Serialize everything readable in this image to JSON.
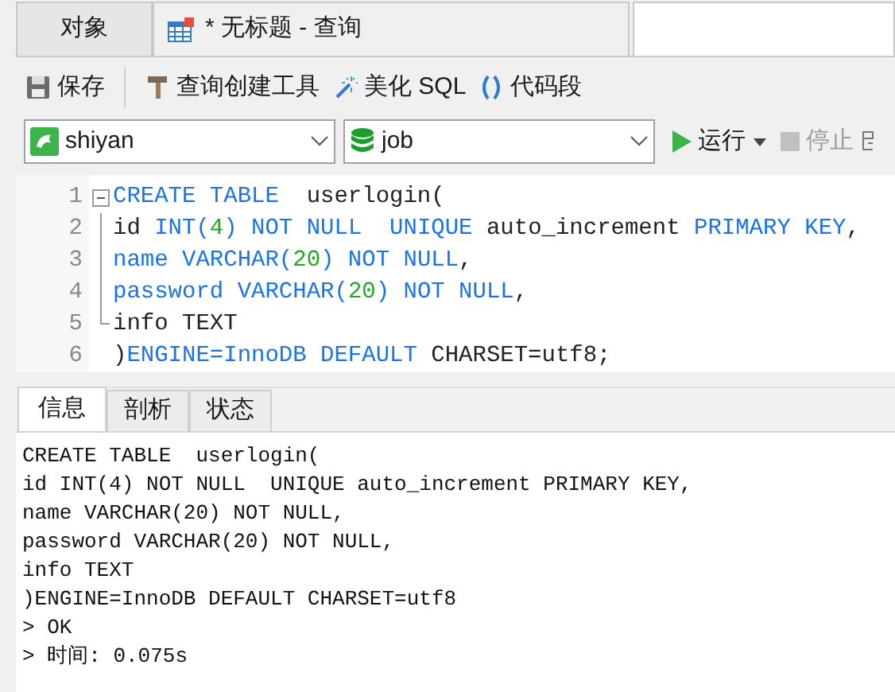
{
  "tabs": [
    {
      "label": "对象",
      "selected": false,
      "kind": "plain"
    },
    {
      "label": "* 无标题 - 查询",
      "selected": true,
      "kind": "query"
    }
  ],
  "toolbar": [
    {
      "label": "保存",
      "kind": "save"
    },
    {
      "label": "查询创建工具",
      "kind": "builder"
    },
    {
      "label": "美化 SQL",
      "kind": "beautify"
    },
    {
      "label": "代码段",
      "kind": "snippet"
    }
  ],
  "connection": {
    "value": "shiyan"
  },
  "database": {
    "value": "job"
  },
  "run": {
    "label": "运行",
    "disabled": false
  },
  "stop": {
    "label": "停止",
    "disabled": true
  },
  "editor": {
    "lines": [
      {
        "number": "1",
        "tokens": [
          {
            "text": "CREATE TABLE",
            "kind": "keyword"
          },
          {
            "text": "  userlogin(",
            "kind": "plain"
          }
        ]
      },
      {
        "number": "2",
        "tokens": [
          {
            "text": "id ",
            "kind": "plain"
          },
          {
            "text": "INT(",
            "kind": "keyword"
          },
          {
            "text": "4",
            "kind": "number"
          },
          {
            "text": ") NOT NULL  UNIQUE",
            "kind": "keyword"
          },
          {
            "text": " auto_increment ",
            "kind": "plain"
          },
          {
            "text": "PRIMARY KEY",
            "kind": "keyword"
          },
          {
            "text": ",",
            "kind": "plain"
          }
        ]
      },
      {
        "number": "3",
        "tokens": [
          {
            "text": "name VARCHAR(",
            "kind": "keyword"
          },
          {
            "text": "20",
            "kind": "number"
          },
          {
            "text": ") NOT NULL",
            "kind": "keyword"
          },
          {
            "text": ",",
            "kind": "plain"
          }
        ]
      },
      {
        "number": "4",
        "tokens": [
          {
            "text": "password VARCHAR(",
            "kind": "keyword"
          },
          {
            "text": "20",
            "kind": "number"
          },
          {
            "text": ") NOT NULL",
            "kind": "keyword"
          },
          {
            "text": ",",
            "kind": "plain"
          }
        ]
      },
      {
        "number": "5",
        "tokens": [
          {
            "text": "info TEXT",
            "kind": "plain"
          }
        ]
      },
      {
        "number": "6",
        "tokens": [
          {
            "text": ")",
            "kind": "plain"
          },
          {
            "text": "ENGINE=InnoDB DEFAULT",
            "kind": "keyword"
          },
          {
            "text": " CHARSET=utf8;",
            "kind": "plain"
          }
        ]
      }
    ]
  },
  "result_tabs": [
    {
      "label": "信息",
      "selected": true
    },
    {
      "label": "剖析",
      "selected": false
    },
    {
      "label": "状态",
      "selected": false
    }
  ],
  "output": [
    "CREATE TABLE  userlogin(",
    "id INT(4) NOT NULL  UNIQUE auto_increment PRIMARY KEY,",
    "name VARCHAR(20) NOT NULL,",
    "password VARCHAR(20) NOT NULL,",
    "info TEXT",
    ")ENGINE=InnoDB DEFAULT CHARSET=utf8",
    "> OK",
    "> 时间: 0.075s"
  ]
}
